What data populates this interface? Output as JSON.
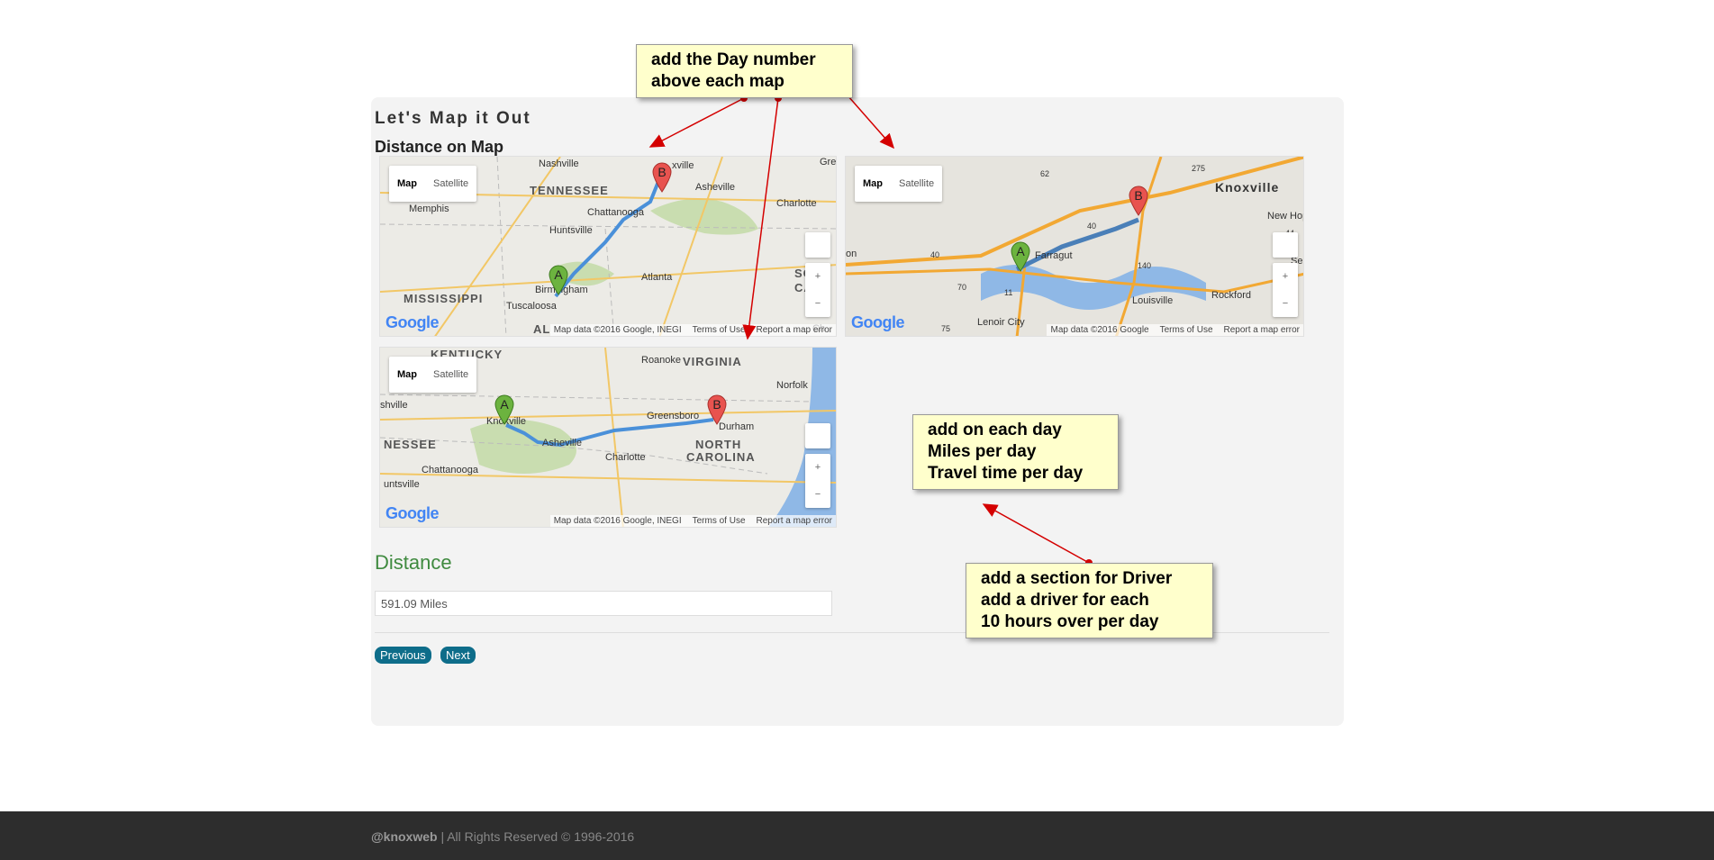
{
  "page": {
    "title": "Let's Map it Out",
    "section_title": "Distance on Map"
  },
  "maps": [
    {
      "type_map": "Map",
      "type_satellite": "Satellite",
      "labels": [
        "Nashville",
        "TENNESSEE",
        "Memphis",
        "Chattanooga",
        "Asheville",
        "Charlotte",
        "Huntsville",
        "MISSISSIPPI",
        "Birmingham",
        "Atlanta",
        "Tuscaloosa",
        "AL",
        "Gre",
        "xville",
        "SO",
        "CAR",
        "Ch"
      ],
      "marker_a": "A",
      "marker_b": "B",
      "logo": "Google",
      "attribution": "Map data ©2016 Google, INEGI",
      "terms": "Terms of Use",
      "report": "Report a map error"
    },
    {
      "type_map": "Map",
      "type_satellite": "Satellite",
      "labels": [
        "Knoxville",
        "Farragut",
        "New Hop",
        "on",
        "Louisville",
        "Rockford",
        "Lenoir City",
        "Se",
        "62",
        "275",
        "40",
        "40",
        "70",
        "11",
        "140",
        "75",
        "44"
      ],
      "marker_a": "A",
      "marker_b": "B",
      "logo": "Google",
      "attribution": "Map data ©2016 Google",
      "terms": "Terms of Use",
      "report": "Report a map error"
    },
    {
      "type_map": "Map",
      "type_satellite": "Satellite",
      "labels": [
        "KENTUCKY",
        "VIRGINIA",
        "Roanoke",
        "Norfolk",
        "shville",
        "Knoxville",
        "Greensboro",
        "Durham",
        "NESSEE",
        "Asheville",
        "NORTH",
        "CAROLINA",
        "Charlotte",
        "Chattanooga",
        "untsville"
      ],
      "marker_a": "A",
      "marker_b": "B",
      "logo": "Google",
      "attribution": "Map data ©2016 Google, INEGI",
      "terms": "Terms of Use",
      "report": "Report a map error"
    }
  ],
  "distance": {
    "title": "Distance",
    "value": "591.09 Miles"
  },
  "buttons": {
    "previous": "Previous",
    "next": "Next"
  },
  "notes": {
    "note1": [
      "add the Day number",
      "above each map"
    ],
    "note2": [
      "add on each day",
      "Miles per day",
      "Travel time per day"
    ],
    "note3": [
      "add a section for Driver",
      "add a driver for each",
      "10 hours over per day"
    ]
  },
  "footer": {
    "brand": "@knoxweb",
    "rights": " | All Rights Reserved © 1996-2016"
  },
  "colors": {
    "accent_button": "#0e6d8a",
    "distance_green": "#3f8a3f",
    "note_bg": "#ffffcc",
    "arrow_red": "#d40000",
    "route_blue": "#4a90d9",
    "footer_bg": "#2d2d2d"
  }
}
